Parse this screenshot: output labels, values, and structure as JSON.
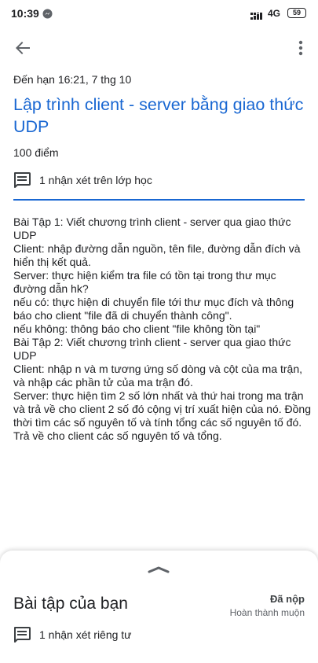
{
  "status_bar": {
    "time": "10:39",
    "network_type": "4G",
    "battery": "59"
  },
  "icons": {
    "back": "arrow-back-icon",
    "more": "more-vert-icon",
    "comment": "comment-icon",
    "handle": "chevron-up-icon"
  },
  "assignment": {
    "due_date": "Đến hạn 16:21, 7 thg 10",
    "title": "Lập trình client - server bằng giao thức UDP",
    "points": "100 điểm",
    "class_comments": "1 nhận xét trên lớp học",
    "description": [
      "Bài Tập 1: Viết chương trình client - server qua giao thức UDP",
      "Client: nhập đường dẫn nguồn, tên file, đường dẫn đích và hiển thị kết quả.",
      "Server: thực hiện kiểm tra file có tồn tại trong thư mục đường dẫn hk?",
      "nếu có: thực hiện di chuyển file tới thư mục đích và thông báo cho client \"file đã di chuyển thành công\".",
      "nếu không: thông báo cho client \"file không tồn tại\"",
      "Bài Tập 2: Viết chương trình client - server qua giao thức UDP",
      "Client: nhập n và m tương ứng số dòng và cột của ma trận, và nhập các phần tử của ma trận đó.",
      "Server: thực hiện tìm 2 số lớn nhất và thứ hai trong ma trận và trả về cho client 2 số đó cộng vị trí xuất hiện của nó. Đồng thời tìm các số nguyên tố và tính tổng các số nguyên tố đó. Trả về cho client các số nguyên tố và tổng."
    ]
  },
  "your_work": {
    "title": "Bài tập của bạn",
    "status": "Đã nộp",
    "substatus": "Hoàn thành muộn",
    "private_comments": "1 nhận xét riêng tư"
  },
  "colors": {
    "accent": "#1967d2",
    "text": "#202124"
  }
}
